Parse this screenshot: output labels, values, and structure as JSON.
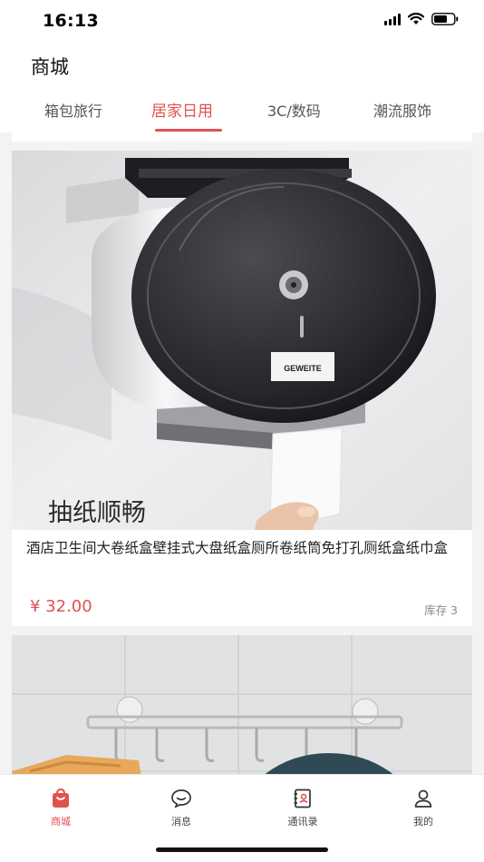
{
  "status_bar": {
    "time": "16:13"
  },
  "header": {
    "title": "商城"
  },
  "tabs": [
    {
      "label": "箱包旅行",
      "active": false
    },
    {
      "label": "居家日用",
      "active": true
    },
    {
      "label": "3C/数码",
      "active": false
    },
    {
      "label": "潮流服饰",
      "active": false
    }
  ],
  "products": [
    {
      "image_caption": "抽纸顺畅",
      "image_brand": "GEWEITE",
      "title": "酒店卫生间大卷纸盒壁挂式大盘纸盒厕所卷纸筒免打孔厕纸盒纸巾盒",
      "price": "¥ 32.00",
      "stock": "库存 3"
    },
    {
      "title": ""
    }
  ],
  "bottom_nav": [
    {
      "label": "商城",
      "icon": "shop-bag-icon",
      "active": true
    },
    {
      "label": "消息",
      "icon": "chat-bubble-icon",
      "active": false
    },
    {
      "label": "通讯录",
      "icon": "contacts-book-icon",
      "active": false
    },
    {
      "label": "我的",
      "icon": "person-icon",
      "active": false
    }
  ],
  "colors": {
    "accent": "#e0524f",
    "background": "#f3f3f3"
  }
}
